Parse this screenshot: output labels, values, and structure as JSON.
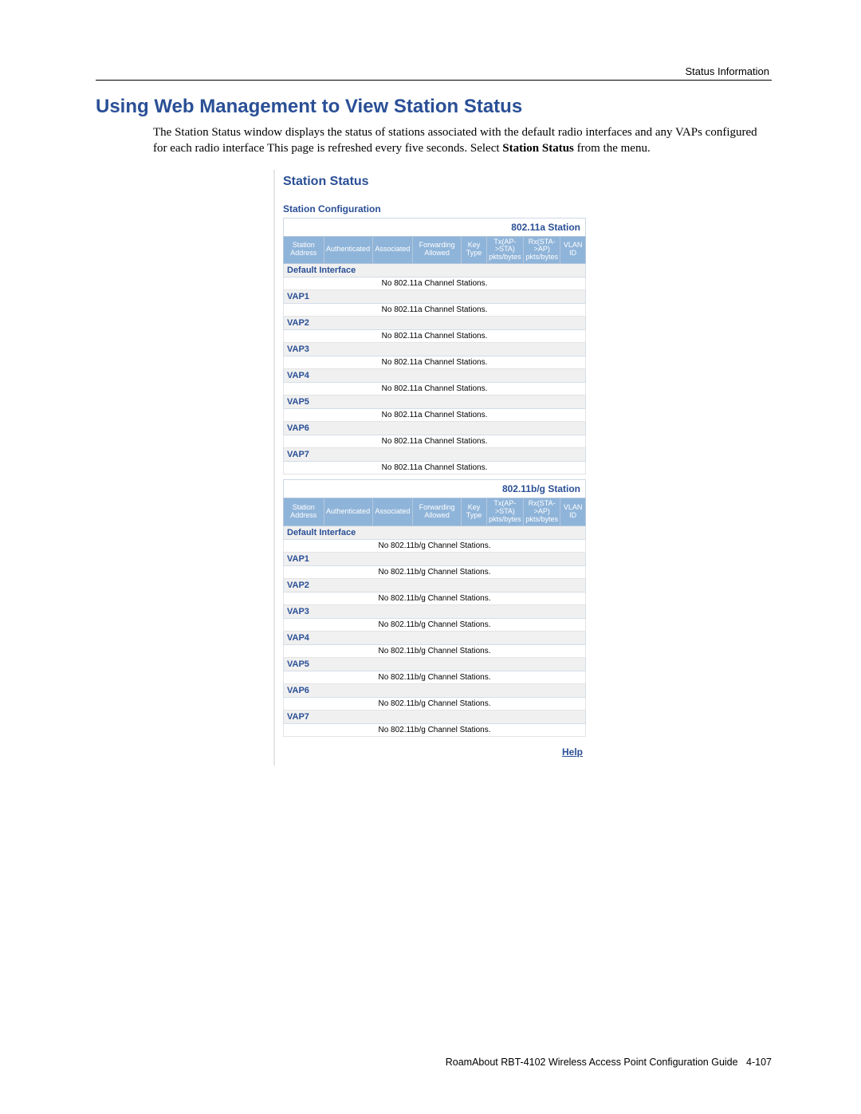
{
  "header": {
    "right": "Status Information"
  },
  "heading": "Using Web Management to View Station Status",
  "intro": {
    "part1": "The Station Status window displays the status of stations associated with the default radio interfaces and any VAPs configured for each radio interface This page is refreshed every five seconds. Select ",
    "bold": "Station Status",
    "part2": " from the menu."
  },
  "panel": {
    "title": "Station Status",
    "subtitle": "Station Configuration",
    "help": "Help",
    "columns": [
      "Station Address",
      "Authenticated",
      "Associated",
      "Forwarding Allowed",
      "Key Type",
      "Tx(AP->STA) pkts/bytes",
      "Rx(STA->AP) pkts/bytes",
      "VLAN ID"
    ],
    "bands": [
      {
        "label": "802.11a Station",
        "rows": [
          {
            "name": "Default Interface",
            "message": "No 802.11a Channel Stations."
          },
          {
            "name": "VAP1",
            "message": "No 802.11a Channel Stations."
          },
          {
            "name": "VAP2",
            "message": "No 802.11a Channel Stations."
          },
          {
            "name": "VAP3",
            "message": "No 802.11a Channel Stations."
          },
          {
            "name": "VAP4",
            "message": "No 802.11a Channel Stations."
          },
          {
            "name": "VAP5",
            "message": "No 802.11a Channel Stations."
          },
          {
            "name": "VAP6",
            "message": "No 802.11a Channel Stations."
          },
          {
            "name": "VAP7",
            "message": "No 802.11a Channel Stations."
          }
        ]
      },
      {
        "label": "802.11b/g Station",
        "rows": [
          {
            "name": "Default Interface",
            "message": "No 802.11b/g Channel Stations."
          },
          {
            "name": "VAP1",
            "message": "No 802.11b/g Channel Stations."
          },
          {
            "name": "VAP2",
            "message": "No 802.11b/g Channel Stations."
          },
          {
            "name": "VAP3",
            "message": "No 802.11b/g Channel Stations."
          },
          {
            "name": "VAP4",
            "message": "No 802.11b/g Channel Stations."
          },
          {
            "name": "VAP5",
            "message": "No 802.11b/g Channel Stations."
          },
          {
            "name": "VAP6",
            "message": "No 802.11b/g Channel Stations."
          },
          {
            "name": "VAP7",
            "message": "No 802.11b/g Channel Stations."
          }
        ]
      }
    ]
  },
  "footer": {
    "text": "RoamAbout RBT-4102 Wireless Access Point Configuration Guide",
    "page": "4-107"
  }
}
